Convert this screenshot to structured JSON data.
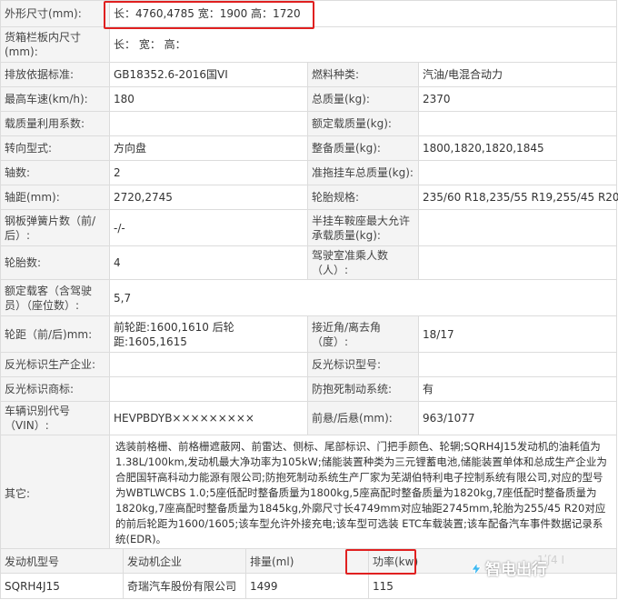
{
  "spec": {
    "dimensions": {
      "label": "外形尺寸(mm):",
      "value": "长：4760,4785  宽：1900  高：1720"
    },
    "cargo": {
      "label": "货箱栏板内尺寸(mm):",
      "value": "长：  宽：  高："
    },
    "emission": {
      "label": "排放依据标准:",
      "value": "GB18352.6-2016国VI"
    },
    "fuel": {
      "label": "燃料种类:",
      "value": "汽油/电混合动力"
    },
    "max_speed": {
      "label": "最高车速(km/h):",
      "value": "180"
    },
    "total_mass": {
      "label": "总质量(kg):",
      "value": "2370"
    },
    "load_util": {
      "label": "载质量利用系数:",
      "value": ""
    },
    "rated_load": {
      "label": "额定载质量(kg):",
      "value": ""
    },
    "steering": {
      "label": "转向型式:",
      "value": "方向盘"
    },
    "curb_mass": {
      "label": "整备质量(kg):",
      "value": "1800,1820,1820,1845"
    },
    "axles": {
      "label": "轴数:",
      "value": "2"
    },
    "trailer_mass": {
      "label": "准拖挂车总质量(kg):",
      "value": ""
    },
    "wheelbase": {
      "label": "轴距(mm):",
      "value": "2720,2745"
    },
    "tire_spec": {
      "label": "轮胎规格:",
      "value": "235/60 R18,235/55 R19,255/45 R20"
    },
    "leaf_spring": {
      "label": "钢板弹簧片数（前/后）:",
      "value": "-/-"
    },
    "saddle_mass": {
      "label": "半挂车鞍座最大允许承载质量(kg):",
      "value": ""
    },
    "tire_count": {
      "label": "轮胎数:",
      "value": "4"
    },
    "cab_passengers": {
      "label": "驾驶室准乘人数（人）:",
      "value": ""
    },
    "seats": {
      "label": "额定载客（含驾驶员）（座位数）:",
      "value": "5,7"
    },
    "track": {
      "label": "轮距（前/后)mm:",
      "value": "前轮距:1600,1610 后轮距:1605,1615"
    },
    "angles": {
      "label": "接近角/离去角（度）:",
      "value": "18/17"
    },
    "reflect_maker": {
      "label": "反光标识生产企业:",
      "value": ""
    },
    "reflect_model": {
      "label": "反光标识型号:",
      "value": ""
    },
    "reflect_mark": {
      "label": "反光标识商标:",
      "value": ""
    },
    "abs": {
      "label": "防抱死制动系统:",
      "value": "有"
    },
    "vin": {
      "label": "车辆识别代号（VIN）:",
      "value": "HEVPBDYB×××××××××"
    },
    "overhang": {
      "label": "前悬/后悬(mm):",
      "value": "963/1077"
    },
    "other": {
      "label": "其它:",
      "value": "选装前格栅、前格栅遮蔽网、前雷达、侧标、尾部标识、门把手颜色、轮辋;SQRH4J15发动机的油耗值为1.38L/100km,发动机最大净功率为105kW;储能装置种类为三元锂蓄电池,储能装置单体和总成生产企业为合肥国轩高科动力能源有限公司;防抱死制动系统生产厂家为芜湖伯特利电子控制系统有限公司,对应的型号为WBTLWCBS 1.0;5座低配时整备质量为1800kg,5座高配时整备质量为1820kg,7座低配时整备质量为1820kg,7座高配时整备质量为1845kg,外廓尺寸长4749mm对应轴距2745mm,轮胎为255/45 R20对应的前后轮距为1600/1605;该车型允许外接充电;该车型可选装 ETC车载装置;该车配备汽车事件数据记录系统(EDR)。"
    }
  },
  "engine": {
    "headers": [
      "发动机型号",
      "发动机企业",
      "排量(ml)",
      "功率(kw)"
    ],
    "rows": [
      [
        "SQRH4J15",
        "奇瑞汽车股份有限公司",
        "1499",
        "115"
      ]
    ]
  },
  "watermark": {
    "text": "智电出行"
  },
  "overlap_text": "1ʹʃ4 I"
}
